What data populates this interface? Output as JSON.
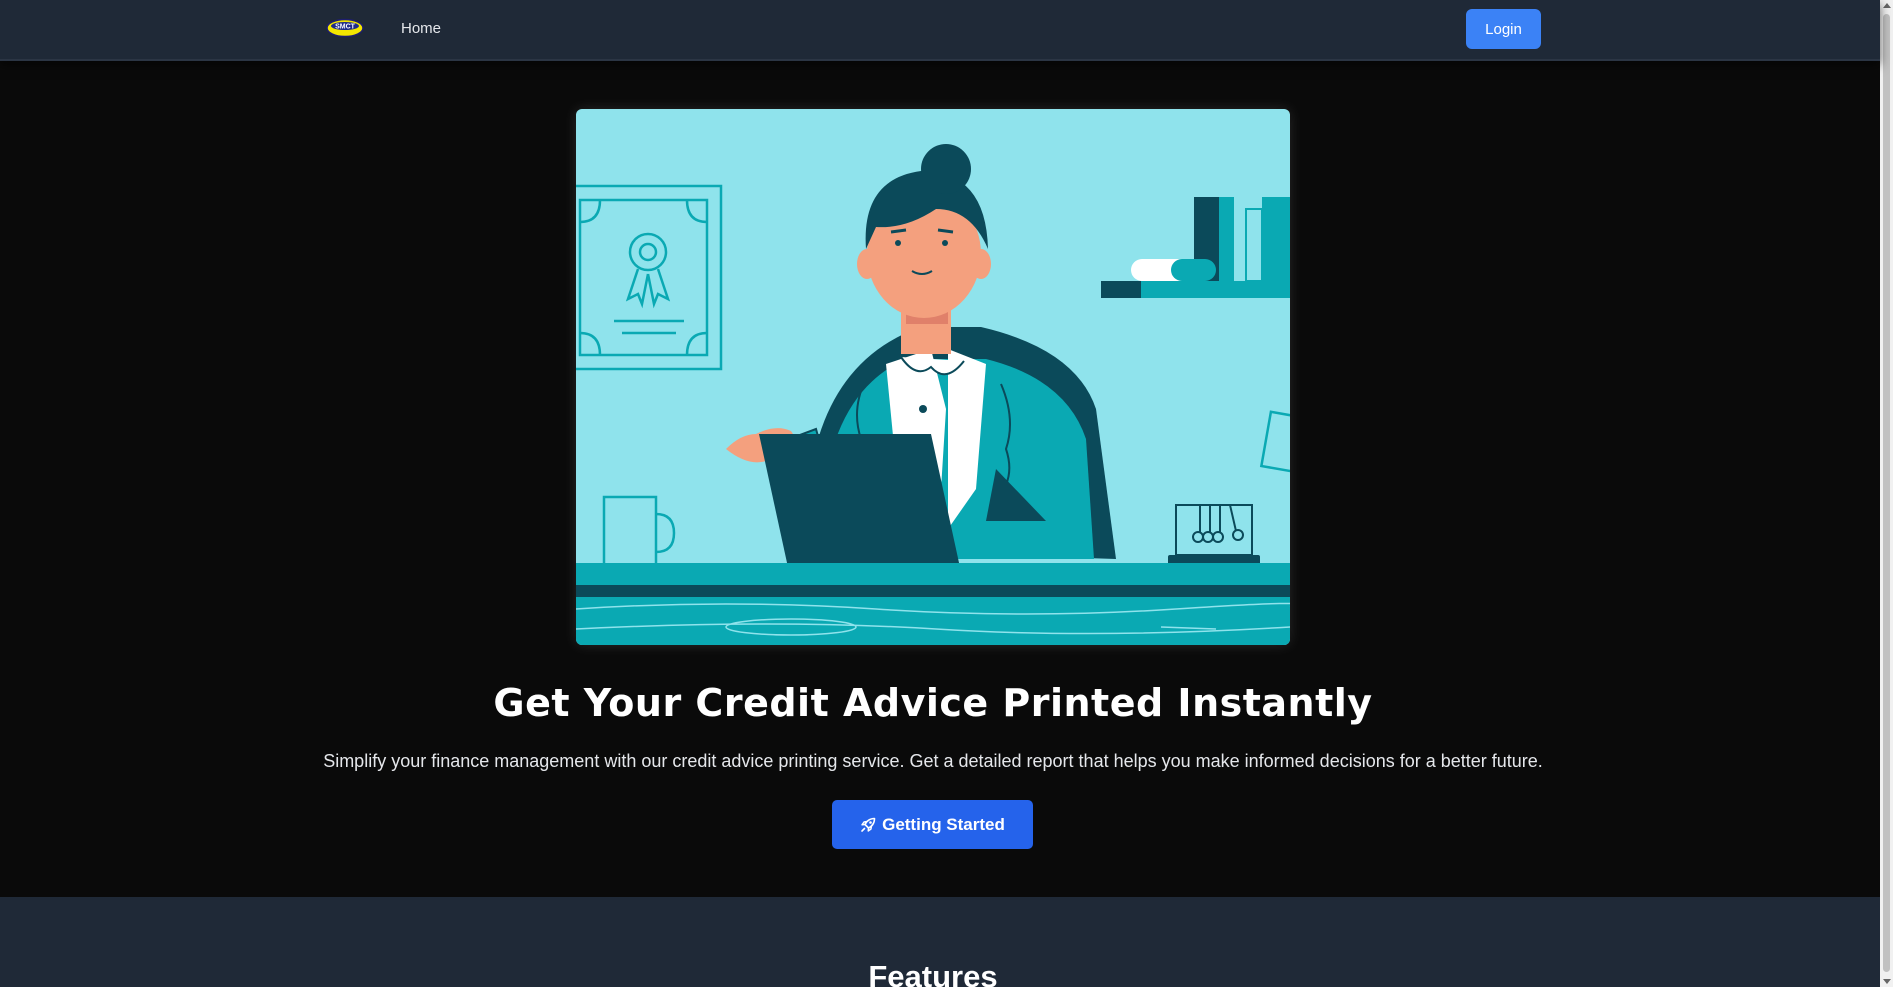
{
  "nav": {
    "logo_text": "SMCT",
    "home_label": "Home",
    "login_label": "Login"
  },
  "hero": {
    "title": "Get Your Credit Advice Printed Instantly",
    "description": "Simplify your finance management with our credit advice printing service. Get a detailed report that helps you make informed decisions for a better future.",
    "cta_label": "Getting Started",
    "cta_icon": "rocket-icon"
  },
  "features": {
    "title": "Features"
  },
  "colors": {
    "nav_bg": "#1f2937",
    "page_bg": "#0a0a0a",
    "primary": "#2563eb",
    "login": "#3b82f6",
    "illustration_bg": "#8fe3ec",
    "teal": "#0aa9b3",
    "dark_teal": "#0b4a5a"
  }
}
